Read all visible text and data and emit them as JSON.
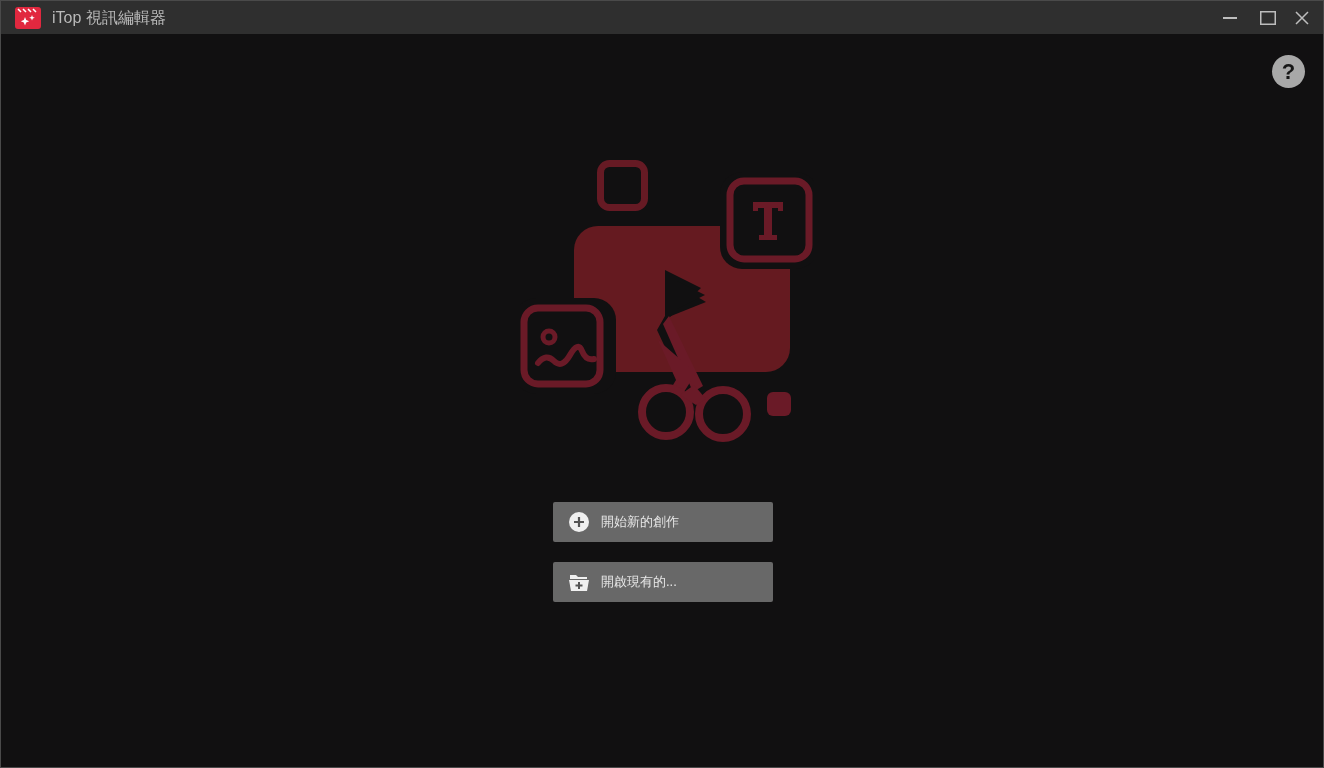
{
  "window": {
    "title": "iTop 視訊編輯器"
  },
  "help": {
    "label": "?"
  },
  "actions": [
    {
      "kind": "new",
      "label": "開始新的創作"
    },
    {
      "kind": "open",
      "label": "開啟現有的..."
    }
  ]
}
